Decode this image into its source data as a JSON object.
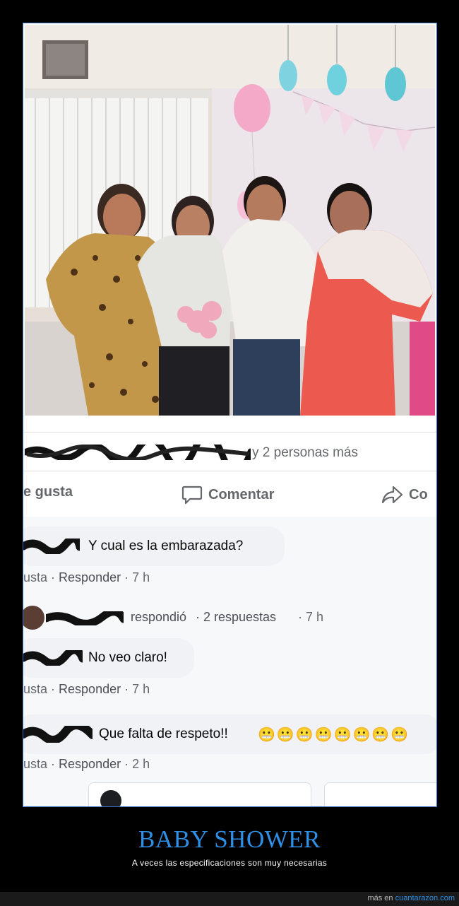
{
  "post": {
    "reactions_text": "y 2 personas más",
    "actions": {
      "like": "e gusta",
      "comment": "Comentar",
      "share": "Co"
    }
  },
  "comments": [
    {
      "text": "Y cual es la embarazada?",
      "like": "usta",
      "reply": "Responder",
      "time": "· 7 h"
    },
    {
      "replied": "respondió",
      "replies": "· 2 respuestas",
      "time": "· 7 h"
    },
    {
      "text": "No veo claro!",
      "like": "usta",
      "reply": "Responder",
      "time": "· 7 h"
    },
    {
      "text": "Que falta de respeto!!",
      "emojis": "😬😬😬😬😬😬😬😬",
      "like": "usta",
      "reply": "Responder",
      "time": "· 2 h"
    }
  ],
  "caption": {
    "title": "BABY SHOWER",
    "subtitle": "A veces las especificaciones son muy necesarias"
  },
  "footer": {
    "prefix": "más en",
    "site": "cuantarazon.com"
  },
  "colors": {
    "accent": "#2f8fe4",
    "frame": "#3b6ec2",
    "bubble": "#f0f2f5",
    "meta": "#65676b"
  },
  "icons": [
    "comment-icon",
    "share-icon"
  ]
}
